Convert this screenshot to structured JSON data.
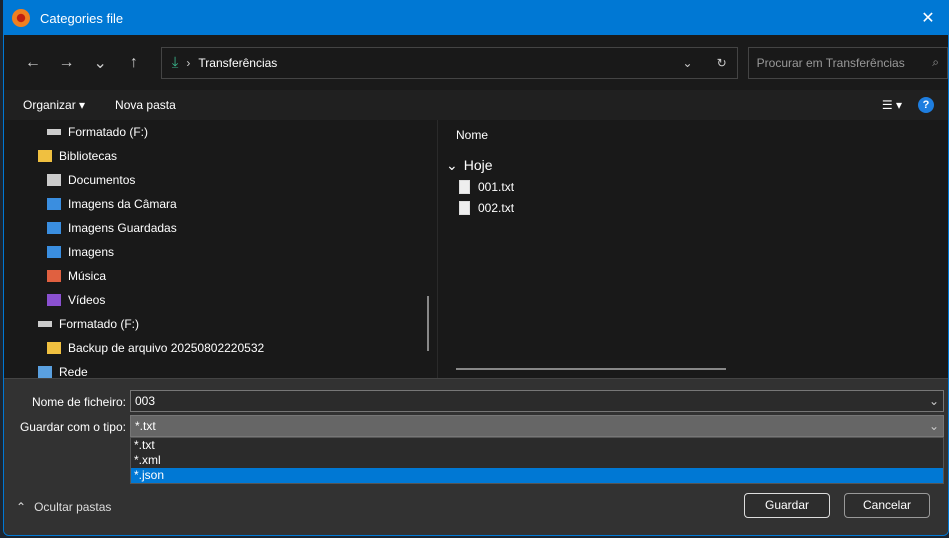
{
  "window": {
    "title": "Categories file",
    "close": "✕"
  },
  "nav": {
    "back": "←",
    "forward": "→",
    "recent": "⌄",
    "up": "↑",
    "path": "Transferências",
    "search_placeholder": "Procurar em Transferências"
  },
  "toolbar": {
    "organize": "Organizar ▾",
    "new_folder": "Nova pasta",
    "view": "☰ ▾",
    "help": "?"
  },
  "tree": [
    {
      "label": "Formatado (F:)",
      "indent": 1,
      "icon": "drive",
      "color": "#ccc"
    },
    {
      "label": "Bibliotecas",
      "indent": 0,
      "icon": "folder",
      "color": "#f0c040"
    },
    {
      "label": "Documentos",
      "indent": 1,
      "icon": "document",
      "color": "#ccc"
    },
    {
      "label": "Imagens da Câmara",
      "indent": 1,
      "icon": "image",
      "color": "#3a8ee0"
    },
    {
      "label": "Imagens Guardadas",
      "indent": 1,
      "icon": "image",
      "color": "#3a8ee0"
    },
    {
      "label": "Imagens",
      "indent": 1,
      "icon": "image",
      "color": "#3a8ee0"
    },
    {
      "label": "Música",
      "indent": 1,
      "icon": "music",
      "color": "#e06040"
    },
    {
      "label": "Vídeos",
      "indent": 1,
      "icon": "video",
      "color": "#8a50d0"
    },
    {
      "label": "Formatado (F:)",
      "indent": 0,
      "icon": "drive",
      "color": "#ccc"
    },
    {
      "label": "Backup de arquivo 20250802220532",
      "indent": 1,
      "icon": "folder",
      "color": "#f0c040"
    },
    {
      "label": "Rede",
      "indent": 0,
      "icon": "network",
      "color": "#5aa0e0"
    }
  ],
  "files": {
    "column": "Nome",
    "group": "Hoje",
    "items": [
      "001.txt",
      "002.txt"
    ]
  },
  "form": {
    "filename_label": "Nome de ficheiro:",
    "filename": "003",
    "type_label": "Guardar com o tipo:",
    "type": "*.txt",
    "options": [
      "*.txt",
      "*.xml",
      "*.json"
    ],
    "selected_option": 2
  },
  "footer": {
    "hide_folders": "Ocultar pastas",
    "save": "Guardar",
    "cancel": "Cancelar"
  }
}
